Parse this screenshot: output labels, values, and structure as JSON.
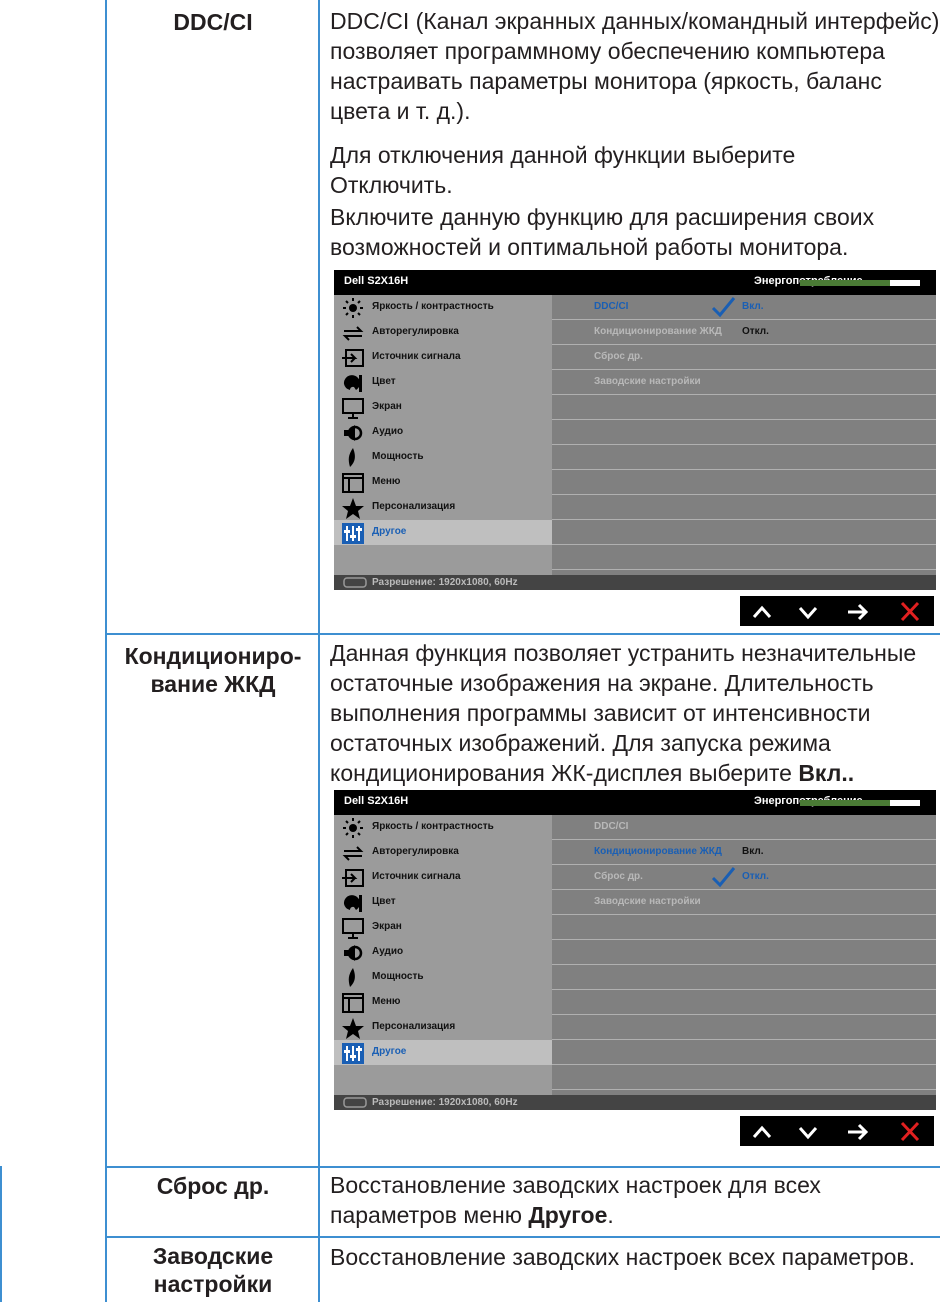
{
  "rows": {
    "ddcci": {
      "label": "DDC/CI",
      "paragraphs": [
        "DDC/CI (Канал экранных данных/командный интерфейс) позволяет программному обеспечению компьютера настраивать параметры монитора (яркость, баланс цвета и т. д.).",
        "Для отключения данной функции выберите Отключить.",
        "Включите данную функцию для расширения своих возможностей и оптимальной работы монитора."
      ]
    },
    "lcd": {
      "label_line1": "Кондициониро-",
      "label_line2": "вание ЖКД",
      "text": "Данная функция позволяет устранить незначительные остаточные изображения на экране. Длительность выполнения программы зависит от интенсивности остаточных изображений. Для запуска режима кондиционирования ЖК-дисплея выберите ",
      "text_bold": "Вкл.."
    },
    "reset_other": {
      "label": "Сброс др.",
      "text": "Восстановление заводских настроек для всех параметров меню ",
      "text_bold": "Другое",
      "text_end": "."
    },
    "factory": {
      "label_line1": "Заводские",
      "label_line2": "настройки",
      "text": "Восстановление заводских настроек всех параметров."
    }
  },
  "osd": {
    "model": "Dell S2X16H",
    "energy_label": "Энергопотребление",
    "energy_level": 0.75,
    "menu": [
      {
        "label": "Яркость / контрастность",
        "icon": "brightness-icon"
      },
      {
        "label": "Авторегулировка",
        "icon": "auto-adjust-icon"
      },
      {
        "label": "Источник сигнала",
        "icon": "input-source-icon"
      },
      {
        "label": "Цвет",
        "icon": "color-icon"
      },
      {
        "label": "Экран",
        "icon": "display-icon"
      },
      {
        "label": "Аудио",
        "icon": "audio-icon"
      },
      {
        "label": "Мощность",
        "icon": "power-icon"
      },
      {
        "label": "Меню",
        "icon": "menu-icon"
      },
      {
        "label": "Персонализация",
        "icon": "star-icon"
      },
      {
        "label": "Другое",
        "icon": "other-icon"
      }
    ],
    "submenu": [
      "DDC/CI",
      "Кондиционирование ЖКД",
      "Сброс др.",
      "Заводские настройки"
    ],
    "option_on": "Вкл.",
    "option_off": "Откл.",
    "status": "Разрешение: 1920x1080, 60Hz",
    "colors": {
      "accent": "#1a5fb4",
      "energy_bar": "#4a7b35",
      "close": "#e02020",
      "rule": "#3d8fd1"
    }
  },
  "nav_buttons": [
    "chevron-up-icon",
    "chevron-down-icon",
    "arrow-right-icon",
    "close-icon"
  ]
}
